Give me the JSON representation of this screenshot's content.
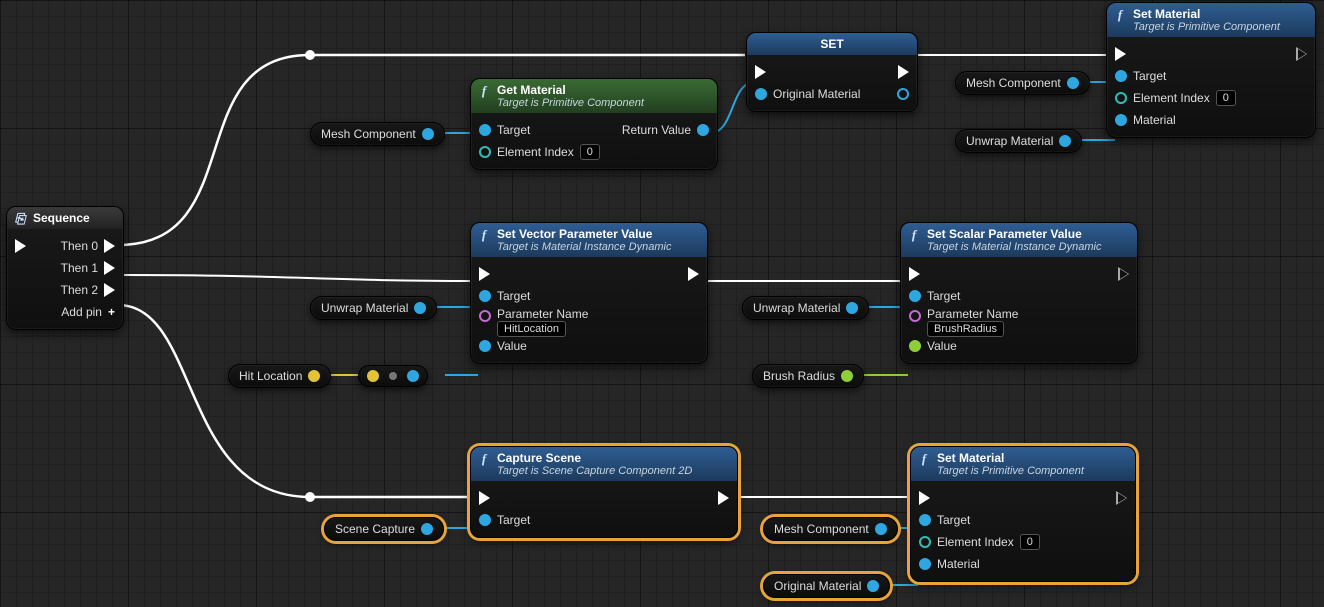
{
  "sequence": {
    "title": "Sequence",
    "pins": {
      "then0": "Then 0",
      "then1": "Then 1",
      "then2": "Then 2",
      "addpin": "Add pin"
    }
  },
  "getMaterial": {
    "title": "Get Material",
    "subtitle": "Target is Primitive Component",
    "pins": {
      "target": "Target",
      "elementIndex": "Element Index",
      "elementIndexVal": "0",
      "returnValue": "Return Value"
    }
  },
  "setNode": {
    "title": "SET",
    "pins": {
      "originalMaterial": "Original Material"
    }
  },
  "setMaterial1": {
    "title": "Set Material",
    "subtitle": "Target is Primitive Component",
    "pins": {
      "target": "Target",
      "elementIndex": "Element Index",
      "elementIndexVal": "0",
      "material": "Material"
    }
  },
  "setVectorParam": {
    "title": "Set Vector Parameter Value",
    "subtitle": "Target is Material Instance Dynamic",
    "pins": {
      "target": "Target",
      "paramName": "Parameter Name",
      "paramNameVal": "HitLocation",
      "value": "Value"
    }
  },
  "setScalarParam": {
    "title": "Set Scalar Parameter Value",
    "subtitle": "Target is Material Instance Dynamic",
    "pins": {
      "target": "Target",
      "paramName": "Parameter Name",
      "paramNameVal": "BrushRadius",
      "value": "Value"
    }
  },
  "captureScene": {
    "title": "Capture Scene",
    "subtitle": "Target is Scene Capture Component 2D",
    "pins": {
      "target": "Target"
    }
  },
  "setMaterial2": {
    "title": "Set Material",
    "subtitle": "Target is Primitive Component",
    "pins": {
      "target": "Target",
      "elementIndex": "Element Index",
      "elementIndexVal": "0",
      "material": "Material"
    }
  },
  "vars": {
    "meshComponent": "Mesh Component",
    "unwrapMaterial": "Unwrap Material",
    "hitLocation": "Hit Location",
    "brushRadius": "Brush Radius",
    "sceneCapture": "Scene Capture",
    "originalMaterial": "Original Material"
  }
}
